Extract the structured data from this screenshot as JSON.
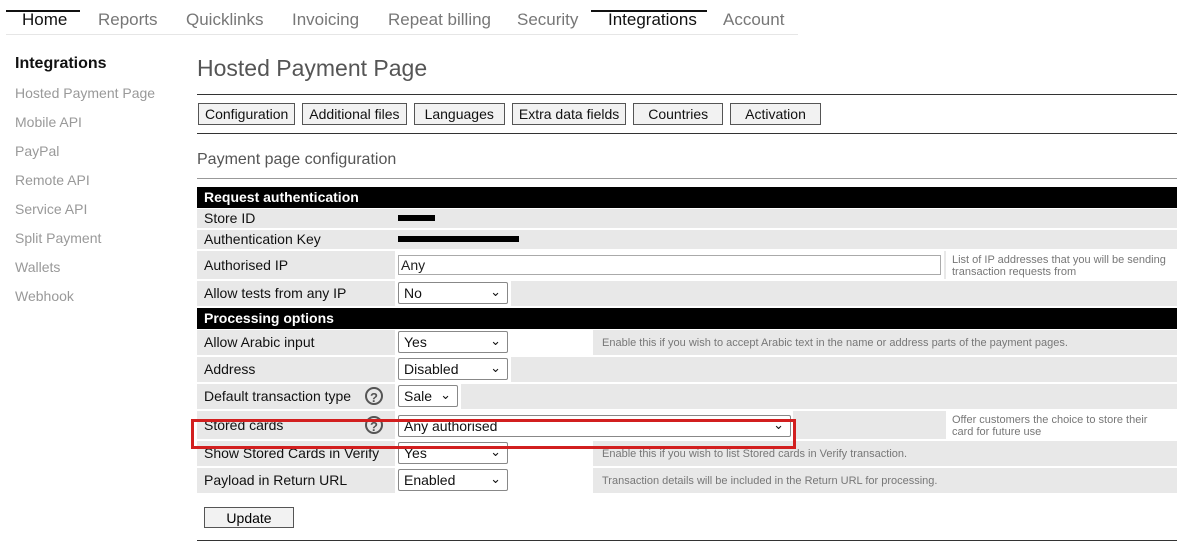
{
  "nav": {
    "tabs": [
      {
        "label": "Home"
      },
      {
        "label": "Reports"
      },
      {
        "label": "Quicklinks"
      },
      {
        "label": "Invoicing"
      },
      {
        "label": "Repeat billing"
      },
      {
        "label": "Security"
      },
      {
        "label": "Integrations"
      },
      {
        "label": "Account"
      }
    ]
  },
  "sidebar": {
    "heading": "Integrations",
    "items": [
      {
        "label": "Hosted Payment Page"
      },
      {
        "label": "Mobile API"
      },
      {
        "label": "PayPal"
      },
      {
        "label": "Remote API"
      },
      {
        "label": "Service API"
      },
      {
        "label": "Split Payment"
      },
      {
        "label": "Wallets"
      },
      {
        "label": "Webhook"
      }
    ]
  },
  "page": {
    "title": "Hosted Payment Page",
    "section_title": "Payment page configuration"
  },
  "subtabs": [
    "Configuration",
    "Additional files",
    "Languages",
    "Extra data fields",
    "Countries",
    "Activation"
  ],
  "auth": {
    "header": "Request authentication",
    "store_id_label": "Store ID",
    "auth_key_label": "Authentication Key",
    "authorised_ip_label": "Authorised IP",
    "authorised_ip_value": "Any",
    "authorised_ip_note": "List of IP addresses that you will be sending transaction requests from",
    "allow_tests_label": "Allow tests from any IP",
    "allow_tests_value": "No"
  },
  "processing": {
    "header": "Processing options",
    "arabic_label": "Allow Arabic input",
    "arabic_value": "Yes",
    "arabic_note": "Enable this if you wish to accept Arabic text in the name or address parts of the payment pages.",
    "address_label": "Address",
    "address_value": "Disabled",
    "default_tx_label": "Default transaction type",
    "default_tx_value": "Sale",
    "stored_cards_label": "Stored cards",
    "stored_cards_value": "Any authorised",
    "stored_cards_note": "Offer customers the choice to store their card for future use",
    "verify_label": "Show Stored Cards in Verify",
    "verify_value": "Yes",
    "verify_note": "Enable this if you wish to list Stored cards in Verify transaction.",
    "payload_label": "Payload in Return URL",
    "payload_value": "Enabled",
    "payload_note": "Transaction details will be included in the Return URL for processing."
  },
  "icons": {
    "help": "question-circle-icon",
    "dropdown": "chevron-down-icon"
  },
  "update_label": "Update",
  "colors": {
    "highlight": "#d21f1f",
    "header_bg": "#000000"
  }
}
